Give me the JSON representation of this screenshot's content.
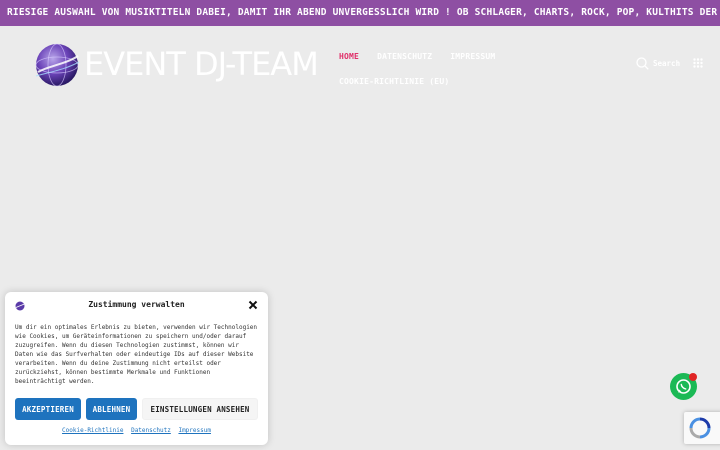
{
  "ticker": {
    "text": "RIESIGE AUSWAHL VON MUSIKTITELN DABEI, DAMIT IHR ABEND UNVERGESSLICH WIRD !  OB SCHLAGER, CHARTS, ROCK, POP, KULTHITS DER LETZTEN"
  },
  "header": {
    "logo_text": "EVENT DJ-TEAM",
    "nav": {
      "row1": [
        "HOME",
        "DATENSCHUTZ",
        "IMPRESSUM"
      ],
      "row2": [
        "COOKIE-RICHTLINIE (EU)"
      ]
    },
    "search_label": "Search"
  },
  "consent": {
    "title": "Zustimmung verwalten",
    "body": "Um dir ein optimales Erlebnis zu bieten, verwenden wir Technologien wie Cookies, um Geräteinformationen zu speichern und/oder darauf zuzugreifen. Wenn du diesen Technologien zustimmst, können wir Daten wie das Surfverhalten oder eindeutige IDs auf dieser Website verarbeiten. Wenn du deine Zustimmung nicht erteilst oder zurückziehst, können bestimmte Merkmale und Funktionen beeinträchtigt werden.",
    "accept_label": "AKZEPTIEREN",
    "deny_label": "ABLEHNEN",
    "settings_label": "EINSTELLUNGEN ANSEHEN",
    "links": [
      "Cookie-Richtlinie",
      "Datenschutz",
      "Impressum"
    ]
  },
  "colors": {
    "ticker_bg": "#8e4fa3",
    "nav_active": "#e0306a",
    "button_primary": "#1e73be",
    "whatsapp": "#1bb955"
  }
}
